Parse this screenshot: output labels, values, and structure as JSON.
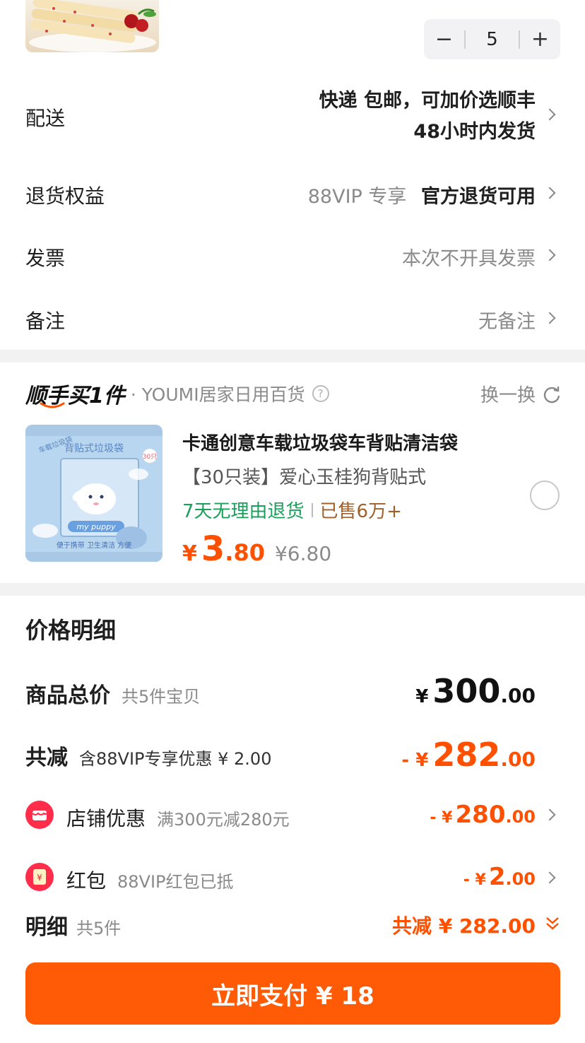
{
  "order": {
    "quantity": "5",
    "minus_label": "−",
    "plus_label": "+",
    "delivery_label": "配送",
    "delivery_line1": "快递 包邮，可加价选顺丰",
    "delivery_line2": "48小时内发货",
    "return_label": "退货权益",
    "return_tag": "88VIP 专享",
    "return_value": "官方退货可用",
    "invoice_label": "发票",
    "invoice_value": "本次不开具发票",
    "remark_label": "备注",
    "remark_value": "无备注"
  },
  "recommend": {
    "title": "顺手买1件",
    "shop": "· YOUMI居家日用百货",
    "refresh_label": "换一换",
    "product_title": "卡通创意车载垃圾袋车背贴清洁袋",
    "product_sub": "【30只装】爱心玉桂狗背贴式",
    "return_tag": "7天无理由退货",
    "sold": "已售6万+",
    "price_symbol": "¥",
    "price_int": "3",
    "price_dec": ".80",
    "price_original": "¥6.80",
    "image_texts": {
      "top": "背贴式垃圾袋",
      "brand": "my puppy",
      "side": "车载垃圾袋",
      "bottom": "便于携带 卫生清洁 方便",
      "tag": "30只"
    }
  },
  "price_detail": {
    "title": "价格明细",
    "total_label": "商品总价",
    "total_sub": "共5件宝贝",
    "total_symbol": "¥",
    "total_int": "300",
    "total_dec": ".00",
    "discount_label": "共减",
    "discount_sub": "含88VIP专享优惠 ¥ 2.00",
    "discount_prefix": "- ¥",
    "discount_int": "282",
    "discount_dec": ".00",
    "shop_label": "店铺优惠",
    "shop_sub": "满300元减280元",
    "shop_prefix": "- ¥",
    "shop_int": "280",
    "shop_dec": ".00",
    "redpack_label": "红包",
    "redpack_sub": "88VIP红包已抵",
    "redpack_prefix": "- ¥",
    "redpack_int": "2",
    "redpack_dec": ".00",
    "detail_label": "明细",
    "detail_sub": "共5件",
    "detail_value": "共减 ¥ 282.00"
  },
  "pay": {
    "label": "立即支付 ¥ 18"
  },
  "colors": {
    "accent": "#ff5000",
    "green": "#1aa05a",
    "brown": "#a0602a"
  }
}
